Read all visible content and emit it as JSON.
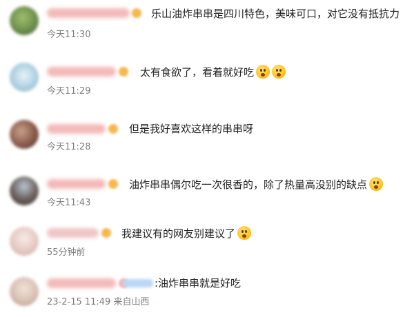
{
  "comments": [
    {
      "text": "乐山油炸串串是四川特色，美味可口，对它没有抵抗力",
      "time": "今天11:30",
      "emojis": [],
      "avatar_color": "#6d8f4e",
      "name_color": "#f0a2a2"
    },
    {
      "text": "太有食欲了，看着就好吃",
      "time": "今天11:29",
      "emojis": [
        "fearful-face-icon",
        "fearful-face-icon"
      ],
      "avatar_color": "#a9cde0",
      "name_color": "#f0a2a2"
    },
    {
      "text": "但是我好喜欢这样的串串呀",
      "time": "今天11:28",
      "emojis": [],
      "avatar_color": "#8a5a4a",
      "name_color": "#f0a2a2"
    },
    {
      "text": "油炸串串偶尔吃一次很香的，除了热量高没别的缺点",
      "time": "今天11:43",
      "emojis": [
        "drooling-face-icon"
      ],
      "avatar_color": "#6a5e5a",
      "name_color": "#f0a2a2"
    },
    {
      "text": "我建议有的网友别建议了",
      "time": "55分钟前",
      "emojis": [
        "laughing-face-icon"
      ],
      "avatar_color": "#e6c9c3",
      "name_color": "#e9b3b3"
    },
    {
      "text": ":油炸串串就是好吃",
      "time": "23-2-15 11:49 来自山西",
      "emojis": [],
      "avatar_color": "#d9c1b4",
      "name_color": "#f0a2a2"
    }
  ]
}
